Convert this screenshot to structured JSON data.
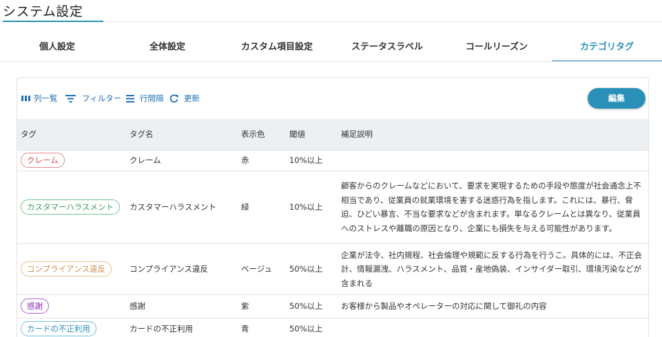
{
  "page": {
    "title": "システム設定"
  },
  "tabs": [
    {
      "label": "個人設定",
      "active": false
    },
    {
      "label": "全体設定",
      "active": false
    },
    {
      "label": "カスタム項目設定",
      "active": false
    },
    {
      "label": "ステータスラベル",
      "active": false
    },
    {
      "label": "コールリーズン",
      "active": false
    },
    {
      "label": "カテゴリタグ",
      "active": true
    }
  ],
  "toolbar": {
    "columns_label": "列一覧",
    "filter_label": "フィルター",
    "density_label": "行間隔",
    "refresh_label": "更新",
    "edit_label": "編集"
  },
  "table": {
    "headers": [
      "タグ",
      "タグ名",
      "表示色",
      "閾値",
      "補足説明"
    ],
    "rows": [
      {
        "tag": "クレーム",
        "name": "クレーム",
        "color": "赤",
        "threshold": "10%以上",
        "description": ""
      },
      {
        "tag": "カスタマーハラスメント",
        "name": "カスタマーハラスメント",
        "color": "緑",
        "threshold": "10%以上",
        "description": "顧客からのクレームなどにおいて、要求を実現するための手段や態度が社会通念上不相当であり、従業員の就業環境を害する迷惑行為を指します。これには、暴行、脅迫、ひどい暴言、不当な要求などが含まれます。単なるクレームとは異なり、従業員へのストレスや離職の原因となり、企業にも損失を与える可能性があります。"
      },
      {
        "tag": "コンプライアンス違反",
        "name": "コンプライアンス違反",
        "color": "ベージュ",
        "threshold": "50%以上",
        "description": "企業が法令、社内規程、社会倫理や規範に反する行為を行うこ。具体的には、不正会計、情報漏洩、ハラスメント、品質・産地偽装、インサイダー取引、環境汚染などが含まれる"
      },
      {
        "tag": "感謝",
        "name": "感謝",
        "color": "紫",
        "threshold": "50%以上",
        "description": "お客様から製品やオペレーターの対応に関して御礼の内容"
      },
      {
        "tag": "カードの不正利用",
        "name": "カードの不正利用",
        "color": "青",
        "threshold": "50%以上",
        "description": ""
      }
    ]
  },
  "colors": {
    "accent": "#2a8fb7",
    "link": "#1e6fb8",
    "header_bg": "#ecf0f3",
    "badge_red": "#d9534f",
    "badge_green": "#3f9b63",
    "badge_beige": "#d09050",
    "badge_purple": "#8a2fb8",
    "badge_blue": "#2a90b8"
  },
  "icons": {
    "columns": "columns-icon",
    "filter": "filter-icon",
    "density": "density-icon",
    "refresh": "refresh-icon"
  }
}
